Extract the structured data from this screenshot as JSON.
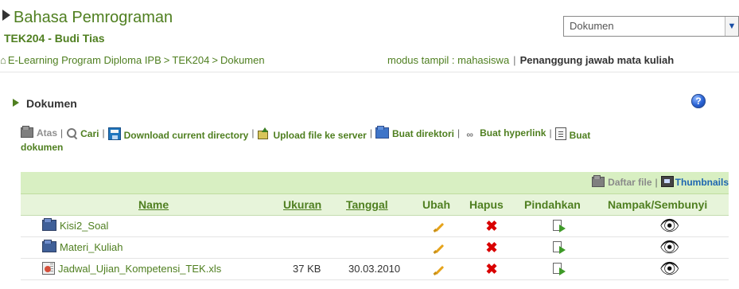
{
  "header": {
    "course_title": "Bahasa Pemrograman",
    "course_subtitle": "TEK204 - Budi Tias",
    "select_value": "Dokumen"
  },
  "breadcrumb": {
    "home_icon": "house-icon",
    "items": [
      "E-Learning Program Diploma IPB",
      "TEK204",
      "Dokumen"
    ],
    "separators": [
      ">",
      ">"
    ]
  },
  "mode": {
    "label": "modus tampil : mahasiswa",
    "separator": "|",
    "responsible_label": "Penanggung jawab mata kuliah"
  },
  "section": {
    "title": "Dokumen",
    "help_icon": "?"
  },
  "actions": {
    "items": [
      "Atas",
      "Cari",
      "Download current directory",
      "Upload file ke server",
      "Buat direktori",
      "Buat hyperlink",
      "Buat",
      "dokumen"
    ],
    "separator": "|"
  },
  "view": {
    "list_label": "Daftar file",
    "separator": "|",
    "thumbnail_label": "Thumbnails"
  },
  "table": {
    "columns": [
      "Name",
      "Ukuran",
      "Tanggal",
      "Ubah",
      "Hapus",
      "Pindahkan",
      "Nampak/Sembunyi"
    ],
    "rows": [
      {
        "name": "Kisi2_Soal",
        "size": "",
        "date": "",
        "icon": "folder-icon"
      },
      {
        "name": "Materi_Kuliah",
        "size": "",
        "date": "",
        "icon": "folder-icon"
      },
      {
        "name": "Jadwal_Ujian_Kompetensi_TEK.xls",
        "size": "37 KB",
        "date": "30.03.2010",
        "icon": "excel-file-icon"
      }
    ]
  }
}
